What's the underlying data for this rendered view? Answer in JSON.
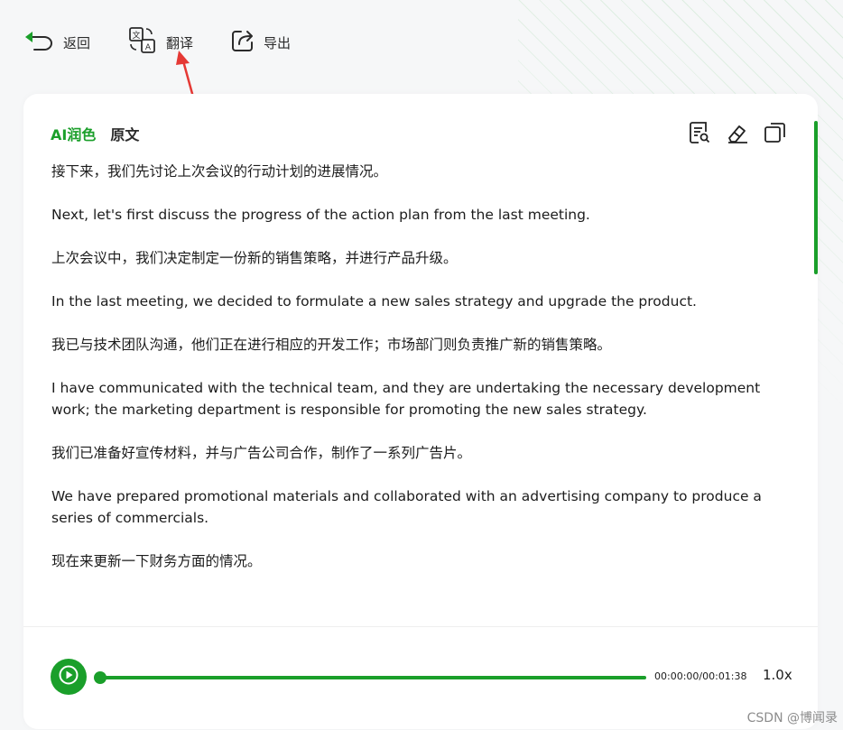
{
  "toolbar": {
    "back_label": "返回",
    "translate_label": "翻译",
    "export_label": "导出"
  },
  "tabs": {
    "ai_polish": "AI润色",
    "original": "原文"
  },
  "content": {
    "paragraphs": [
      "接下来，我们先讨论上次会议的行动计划的进展情况。",
      "Next, let's first discuss the progress of the action plan from the last meeting.",
      "上次会议中，我们决定制定一份新的销售策略，并进行产品升级。",
      "In the last meeting, we decided to formulate a new sales strategy and upgrade the product.",
      "我已与技术团队沟通，他们正在进行相应的开发工作；市场部门则负责推广新的销售策略。",
      "I have communicated with the technical team, and they are undertaking the necessary development work; the marketing department is responsible for promoting the new sales strategy.",
      "我们已准备好宣传材料，并与广告公司合作，制作了一系列广告片。",
      "We have prepared promotional materials and collaborated with an advertising company to produce a series of commercials.",
      "现在来更新一下财务方面的情况。"
    ]
  },
  "player": {
    "time": "00:00:00/00:01:38",
    "speed": "1.0x",
    "progress": 0
  },
  "colors": {
    "accent": "#1a9f2a",
    "annotation": "#e53935"
  },
  "icons": {
    "back": "back-arrow-icon",
    "translate": "translate-icon",
    "export": "export-icon",
    "search_doc": "document-search-icon",
    "edit": "eraser-edit-icon",
    "copy": "copy-icon",
    "play": "play-icon"
  },
  "watermark": "CSDN @博闻录"
}
